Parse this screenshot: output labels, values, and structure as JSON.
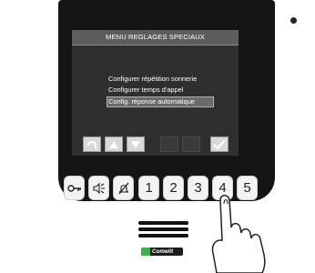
{
  "screen": {
    "title": "MENU REGLAGES SPECIAUX",
    "menu_items": [
      {
        "label": "Configurer répétition sonnerie"
      },
      {
        "label": "Configurer temps d'appel"
      },
      {
        "label": "Config. réponse automatique",
        "selected": true
      }
    ],
    "softkeys": [
      "back-icon",
      "arrow-up-icon",
      "arrow-down-icon",
      "",
      "",
      "check-icon"
    ]
  },
  "keypad": {
    "keys": [
      {
        "label": "",
        "icon": "key-icon"
      },
      {
        "label": "",
        "icon": "speaker-icon"
      },
      {
        "label": "",
        "icon": "bell-muted-icon"
      },
      {
        "label": "1"
      },
      {
        "label": "2"
      },
      {
        "label": "3"
      },
      {
        "label": "4"
      },
      {
        "label": "5"
      }
    ]
  },
  "brand": {
    "logo_text": "Comelit"
  },
  "colors": {
    "bezel": "#151515",
    "screen": "#2f2f2f",
    "title_bar": "#5d5d5d",
    "logo_green": "#3bb24a"
  }
}
